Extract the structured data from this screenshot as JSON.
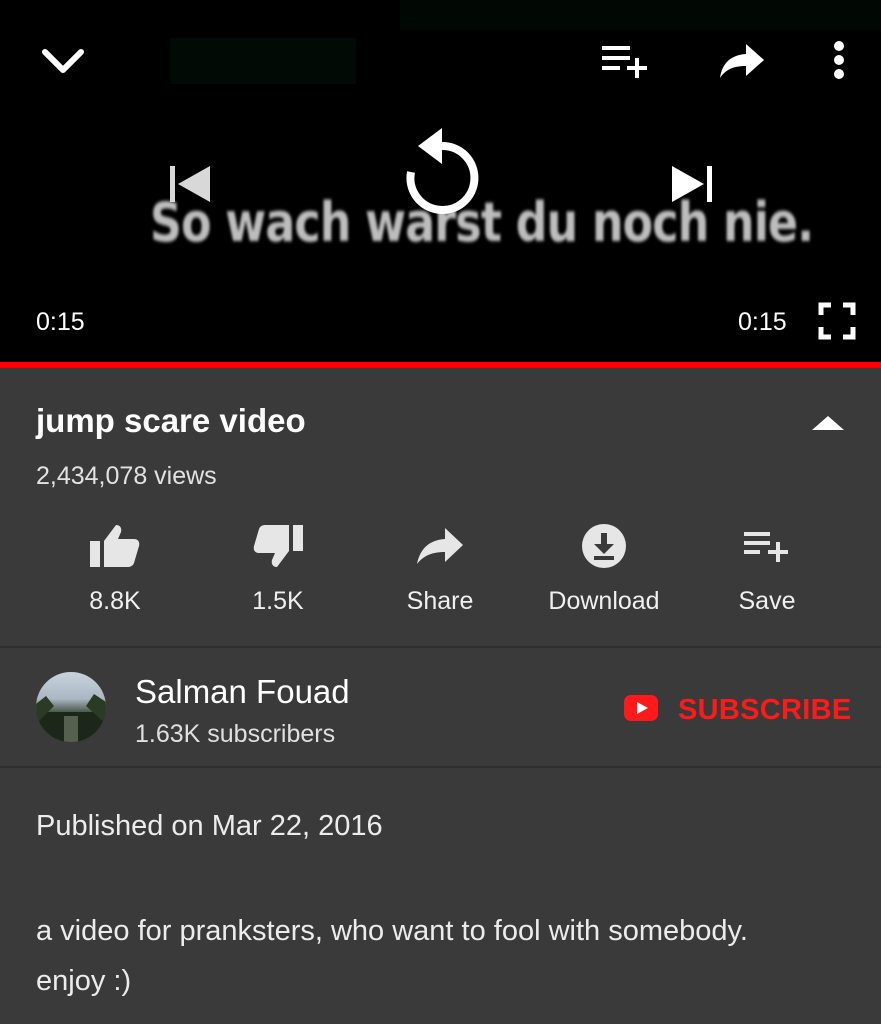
{
  "player": {
    "caption_text": "So wach warst du noch nie.",
    "elapsed": "0:15",
    "duration": "0:15",
    "progress_fraction": 1.0,
    "controls": [
      "collapse-icon",
      "add-to-queue-icon",
      "share-icon",
      "more-icon",
      "previous-icon",
      "replay-icon",
      "next-icon",
      "fullscreen-icon"
    ]
  },
  "video": {
    "title": "jump scare video",
    "views": "2,434,078 views"
  },
  "actions": [
    {
      "icon": "thumbs-up-icon",
      "label": "8.8K"
    },
    {
      "icon": "thumbs-down-icon",
      "label": "1.5K"
    },
    {
      "icon": "share-icon",
      "label": "Share"
    },
    {
      "icon": "download-icon",
      "label": "Download"
    },
    {
      "icon": "playlist-add-icon",
      "label": "Save"
    }
  ],
  "channel": {
    "name": "Salman Fouad",
    "subscribers": "1.63K subscribers",
    "subscribe_label": "SUBSCRIBE"
  },
  "description": {
    "published": "Published on Mar 22, 2016",
    "text_line1": "a video for pranksters, who want to fool with somebody.",
    "text_line2": "enjoy :)"
  },
  "colors": {
    "accent": "#ff0000",
    "background": "#3a3a3a",
    "player_background": "#000000",
    "subscribe": "#ff1a1a"
  }
}
